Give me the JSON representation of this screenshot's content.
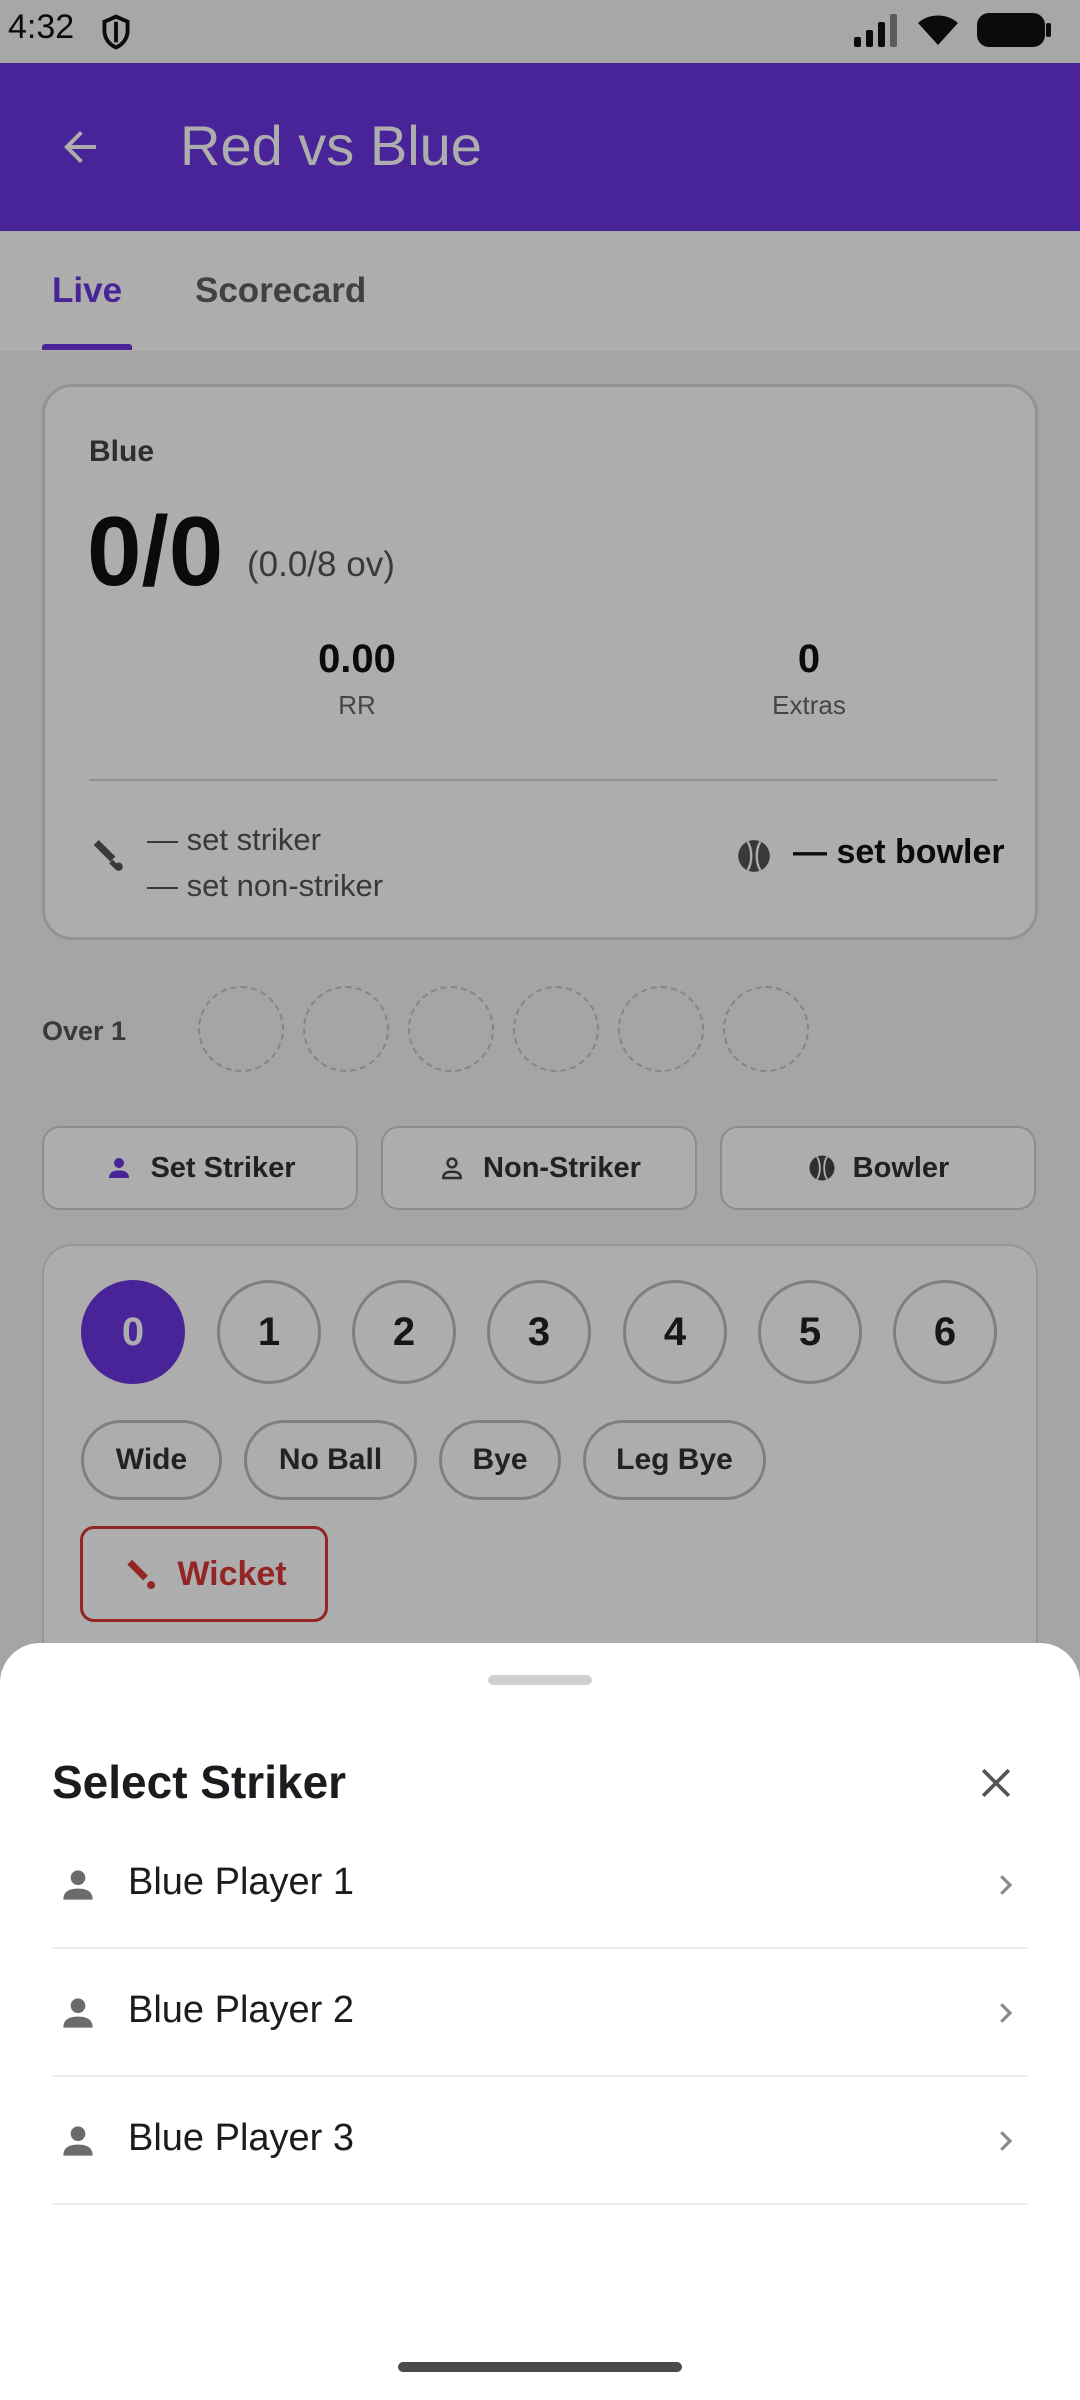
{
  "status_bar": {
    "time": "4:32"
  },
  "app_bar": {
    "title": "Red vs Blue"
  },
  "tabs": [
    {
      "label": "Live"
    },
    {
      "label": "Scorecard"
    }
  ],
  "score_card": {
    "team": "Blue",
    "score": "0/0",
    "overs": "(0.0/8 ov)",
    "run_rate": {
      "value": "0.00",
      "label": "RR"
    },
    "extras": {
      "value": "0",
      "label": "Extras"
    },
    "striker": "— set striker",
    "non_striker": "— set non-striker",
    "bowler": "— set bowler"
  },
  "over": {
    "label": "Over 1",
    "balls_total": 6
  },
  "selection_buttons": {
    "striker": "Set Striker",
    "non_striker": "Non-Striker",
    "bowler": "Bowler"
  },
  "runs": [
    "0",
    "1",
    "2",
    "3",
    "4",
    "5",
    "6"
  ],
  "selected_run": "0",
  "extras_buttons": [
    "Wide",
    "No Ball",
    "Bye",
    "Leg Bye"
  ],
  "wicket_label": "Wicket",
  "sheet": {
    "title": "Select Striker",
    "players": [
      {
        "name": "Blue Player 1"
      },
      {
        "name": "Blue Player 2"
      },
      {
        "name": "Blue Player 3"
      }
    ]
  },
  "colors": {
    "primary": "#6a35e0",
    "wicket": "#d93737"
  },
  "icons": {
    "back": "arrow-left-icon",
    "close": "close-icon",
    "player": "person-icon",
    "chevron": "chevron-right-icon",
    "bat": "cricket-bat-icon",
    "ball": "cricket-ball-icon"
  }
}
